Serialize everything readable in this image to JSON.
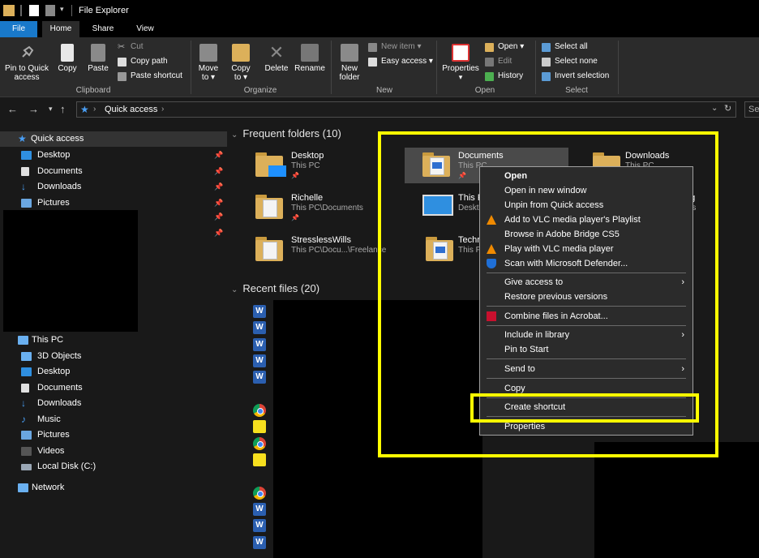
{
  "window": {
    "title": "File Explorer"
  },
  "tabs": [
    {
      "label": "File"
    },
    {
      "label": "Home"
    },
    {
      "label": "Share"
    },
    {
      "label": "View"
    }
  ],
  "ribbon": {
    "clipboard": {
      "pin_label_1": "Pin to Quick",
      "pin_label_2": "access",
      "copy": "Copy",
      "paste": "Paste",
      "cut": "Cut",
      "copy_path": "Copy path",
      "paste_shortcut": "Paste shortcut",
      "group": "Clipboard"
    },
    "organize": {
      "move_1": "Move",
      "move_2": "to",
      "copy_1": "Copy",
      "copy_2": "to",
      "delete": "Delete",
      "rename": "Rename",
      "group": "Organize"
    },
    "new": {
      "folder_1": "New",
      "folder_2": "folder",
      "new_item": "New item",
      "easy_access": "Easy access",
      "group": "New"
    },
    "open": {
      "properties": "Properties",
      "open": "Open",
      "edit": "Edit",
      "history": "History",
      "group": "Open"
    },
    "select": {
      "select_all": "Select all",
      "select_none": "Select none",
      "invert": "Invert selection",
      "group": "Select"
    }
  },
  "address": {
    "path": "Quick access",
    "search_placeholder": "Se"
  },
  "nav": {
    "quick_access": "Quick access",
    "quick_items": [
      "Desktop",
      "Documents",
      "Downloads",
      "Pictures"
    ],
    "this_pc": "This PC",
    "pc_items": [
      "3D Objects",
      "Desktop",
      "Documents",
      "Downloads",
      "Music",
      "Pictures",
      "Videos",
      "Local Disk (C:)"
    ],
    "network": "Network"
  },
  "content": {
    "frequent_header": "Frequent folders (10)",
    "recent_header": "Recent files (20)",
    "folders": [
      {
        "name": "Desktop",
        "path": "This PC"
      },
      {
        "name": "Documents",
        "path": "This PC"
      },
      {
        "name": "Downloads",
        "path": "This PC"
      },
      {
        "name": "Richelle",
        "path": "This PC\\Documents"
      },
      {
        "name": "This P",
        "path": "Deskt"
      },
      {
        "name": "ng",
        "path": "nts"
      },
      {
        "name": "StresslessWills",
        "path": "This PC\\Docu...\\Freelance"
      },
      {
        "name": "Techr",
        "path": "This P"
      }
    ],
    "recent_icons": [
      "word",
      "word",
      "word",
      "word",
      "word",
      "chrome",
      "js",
      "chrome",
      "js",
      "chrome",
      "word",
      "word",
      "word"
    ]
  },
  "context_menu": {
    "items": [
      {
        "label": "Open",
        "bold": true
      },
      {
        "label": "Open in new window"
      },
      {
        "label": "Unpin from Quick access"
      },
      {
        "label": "Add to VLC media player's Playlist",
        "icon": "vlc-icon"
      },
      {
        "label": "Browse in Adobe Bridge CS5"
      },
      {
        "label": "Play with VLC media player",
        "icon": "vlc-icon"
      },
      {
        "label": "Scan with Microsoft Defender...",
        "icon": "defender-icon"
      },
      {
        "label": "Give access to",
        "submenu": true
      },
      {
        "label": "Restore previous versions"
      },
      {
        "label": "Combine files in Acrobat...",
        "icon": "acrobat-icon"
      },
      {
        "label": "Include in library",
        "submenu": true
      },
      {
        "label": "Pin to Start"
      },
      {
        "label": "Send to",
        "submenu": true
      },
      {
        "label": "Copy"
      },
      {
        "label": "Create shortcut"
      },
      {
        "label": "Properties"
      }
    ]
  },
  "colors": {
    "accent": "#1979ca",
    "highlight": "#ffff00",
    "background": "#191919",
    "ribbon": "#2b2b2b"
  }
}
